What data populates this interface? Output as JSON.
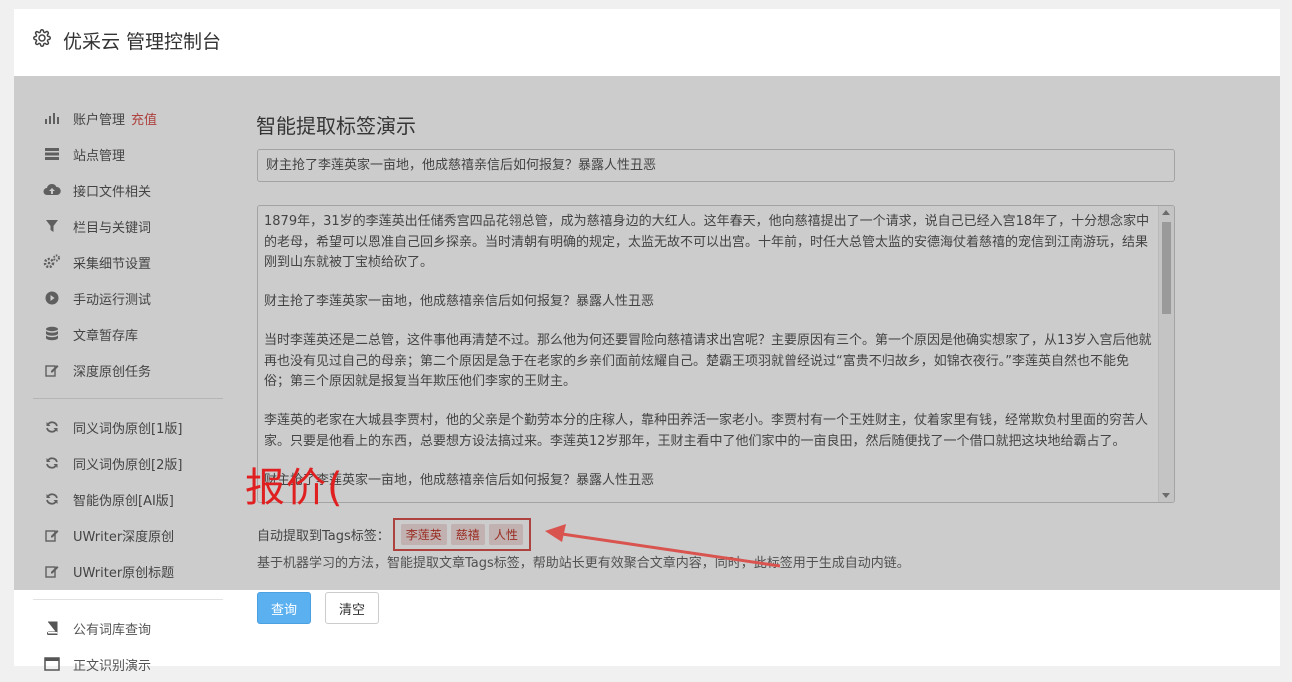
{
  "header": {
    "title": "优采云 管理控制台",
    "icon": "gear-icon"
  },
  "sidebar": {
    "group1": [
      {
        "label": "账户管理",
        "extra": "充值",
        "icon": "bar-chart-icon"
      },
      {
        "label": "站点管理",
        "icon": "server-icon"
      },
      {
        "label": "接口文件相关",
        "icon": "cloud-upload-icon"
      },
      {
        "label": "栏目与关键词",
        "icon": "filter-icon"
      },
      {
        "label": "采集细节设置",
        "icon": "gears-icon"
      },
      {
        "label": "手动运行测试",
        "icon": "play-icon"
      },
      {
        "label": "文章暂存库",
        "icon": "database-icon"
      },
      {
        "label": "深度原创任务",
        "icon": "edit-icon"
      }
    ],
    "group2": [
      {
        "label": "同义词伪原创[1版]",
        "icon": "refresh-icon"
      },
      {
        "label": "同义词伪原创[2版]",
        "icon": "refresh-icon"
      },
      {
        "label": "智能伪原创[AI版]",
        "icon": "refresh-icon"
      },
      {
        "label": "UWriter深度原创",
        "icon": "edit-icon"
      },
      {
        "label": "UWriter原创标题",
        "icon": "edit-icon"
      }
    ],
    "group3": [
      {
        "label": "公有词库查询",
        "icon": "book-icon"
      },
      {
        "label": "正文识别演示",
        "icon": "window-icon"
      }
    ]
  },
  "main": {
    "title": "智能提取标签演示",
    "title_input": "财主抢了李莲英家一亩地，他成慈禧亲信后如何报复？暴露人性丑恶",
    "content": [
      "1879年，31岁的李莲英出任储秀宫四品花翎总管，成为慈禧身边的大红人。这年春天，他向慈禧提出了一个请求，说自己已经入宫18年了，十分想念家中的老母，希望可以恩准自己回乡探亲。当时清朝有明确的规定，太监无故不可以出宫。十年前，时任大总管太监的安德海仗着慈禧的宠信到江南游玩，结果刚到山东就被丁宝桢给砍了。",
      "财主抢了李莲英家一亩地，他成慈禧亲信后如何报复？暴露人性丑恶",
      "当时李莲英还是二总管，这件事他再清楚不过。那么他为何还要冒险向慈禧请求出宫呢？主要原因有三个。第一个原因是他确实想家了，从13岁入宫后他就再也没有见过自己的母亲；第二个原因是急于在老家的乡亲们面前炫耀自己。楚霸王项羽就曾经说过“富贵不归故乡，如锦衣夜行。”李莲英自然也不能免俗；第三个原因就是报复当年欺压他们李家的王财主。",
      "李莲英的老家在大城县李贾村，他的父亲是个勤劳本分的庄稼人，靠种田养活一家老小。李贾村有一个王姓财主，仗着家里有钱，经常欺负村里面的穷苦人家。只要是他看上的东西，总要想方设法搞过来。李莲英12岁那年，王财主看中了他们家中的一亩良田，然后随便找了一个借口就把这块地给霸占了。",
      "财主抢了李莲英家一亩地，他成慈禧亲信后如何报复？暴露人性丑恶"
    ],
    "tags_label": "自动提取到Tags标签：",
    "tags": [
      "李莲英",
      "慈禧",
      "人性"
    ],
    "description": "基于机器学习的方法，智能提取文章Tags标签，帮助站长更有效聚合文章内容，同时，此标签用于生成自动内链。",
    "query_button": "查询",
    "clear_button": "清空"
  },
  "annotation": {
    "text": "报价(",
    "color": "#e02020"
  }
}
